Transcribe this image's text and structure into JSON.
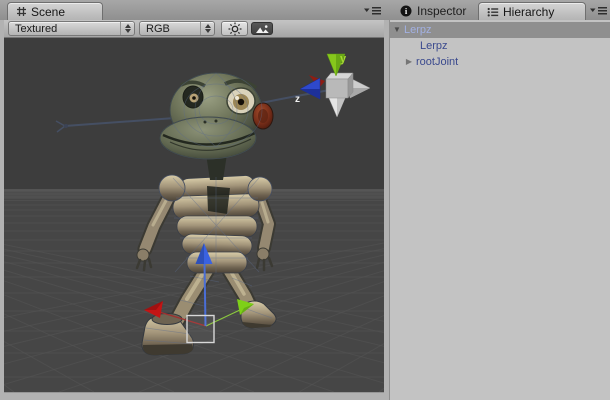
{
  "tabs": {
    "scene": "Scene",
    "inspector": "Inspector",
    "hierarchy": "Hierarchy"
  },
  "scene_toolbar": {
    "render_mode": "Textured",
    "color_mode": "RGB"
  },
  "hierarchy_tree": {
    "rows": [
      {
        "label": "Lerpz",
        "depth": 0,
        "state": "expanded",
        "selected": true
      },
      {
        "label": "Lerpz",
        "depth": 1,
        "state": "leaf",
        "selected": false
      },
      {
        "label": "rootJoint",
        "depth": 1,
        "state": "collapsed",
        "selected": false
      }
    ]
  },
  "viewport": {
    "selected_object": "Lerpz",
    "axis_labels": {
      "y": "y",
      "z": "z"
    }
  },
  "icons": {
    "scene_tab_icon": "grid-icon",
    "inspector_icon": "info-icon",
    "hierarchy_icon": "list-icon",
    "panel_menu_icon": "caret-menu-icon",
    "lighting_toggle_icon": "sun-icon",
    "overlay_toggle_icon": "image-icon",
    "dropdown_arrow_icon": "up-down-arrows",
    "disclosure_expanded": "▼",
    "disclosure_collapsed": "▶"
  },
  "colors": {
    "axis_x": "#c41414",
    "axis_y": "#7ed018",
    "axis_z": "#3a62e0",
    "selected_row_bg": "#8f8f8f",
    "selected_row_text": "#a2b0e2",
    "prefab_text": "#3b4a8e",
    "viewport_bg": "#3d3d3d"
  }
}
